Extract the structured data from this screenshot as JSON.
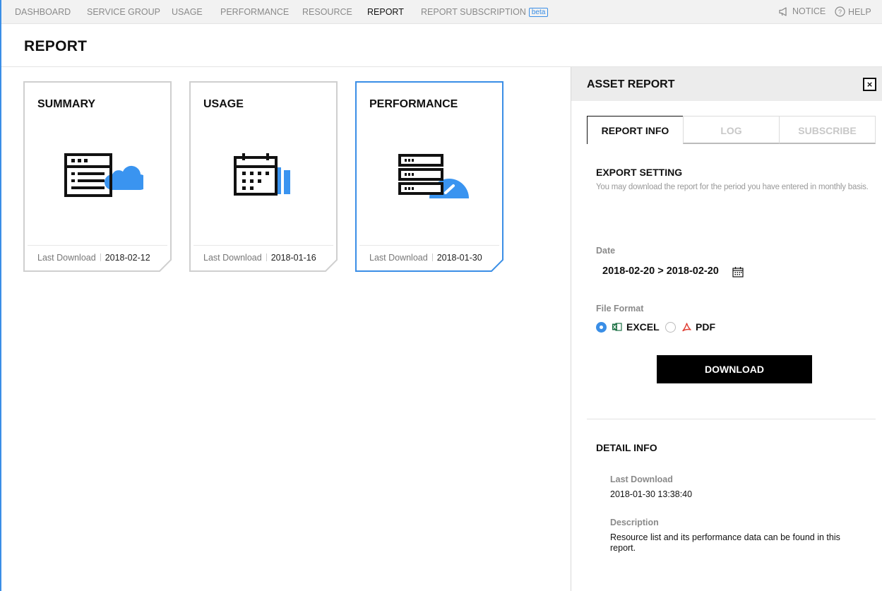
{
  "nav": {
    "items": [
      "DASHBOARD",
      "SERVICE GROUP",
      "USAGE",
      "PERFORMANCE",
      "RESOURCE",
      "REPORT",
      "REPORT SUBSCRIPTION"
    ],
    "beta_badge": "beta",
    "notice": "NOTICE",
    "help": "HELP",
    "active": "REPORT"
  },
  "page": {
    "title": "REPORT"
  },
  "cards": [
    {
      "title": "SUMMARY",
      "meta_label": "Last Download",
      "date": "2018-02-12",
      "icon": "summary-window-cloud-icon"
    },
    {
      "title": "USAGE",
      "meta_label": "Last Download",
      "date": "2018-01-16",
      "icon": "calendar-bar-chart-icon"
    },
    {
      "title": "PERFORMANCE",
      "meta_label": "Last Download",
      "date": "2018-01-30",
      "icon": "server-gauge-icon"
    }
  ],
  "panel": {
    "title": "ASSET REPORT",
    "close": "×",
    "tabs": [
      "REPORT INFO",
      "LOG",
      "SUBSCRIBE"
    ],
    "export": {
      "title": "EXPORT SETTING",
      "description": "You may download the report for the period you have entered in monthly basis.",
      "date_label": "Date",
      "date_range": "2018-02-20 > 2018-02-20",
      "format_label": "File Format",
      "formats": [
        "EXCEL",
        "PDF"
      ],
      "selected_format": "EXCEL",
      "download": "DOWNLOAD"
    },
    "detail": {
      "title": "DETAIL INFO",
      "last_download_label": "Last Download",
      "last_download": "2018-01-30 13:38:40",
      "description_label": "Description",
      "description": "Resource list and its performance data can be found in this report."
    }
  },
  "colors": {
    "accent": "#3a8ee6",
    "icon_blue": "#3a94f0",
    "excel_green": "#1e7145",
    "pdf_red": "#e03c31"
  }
}
